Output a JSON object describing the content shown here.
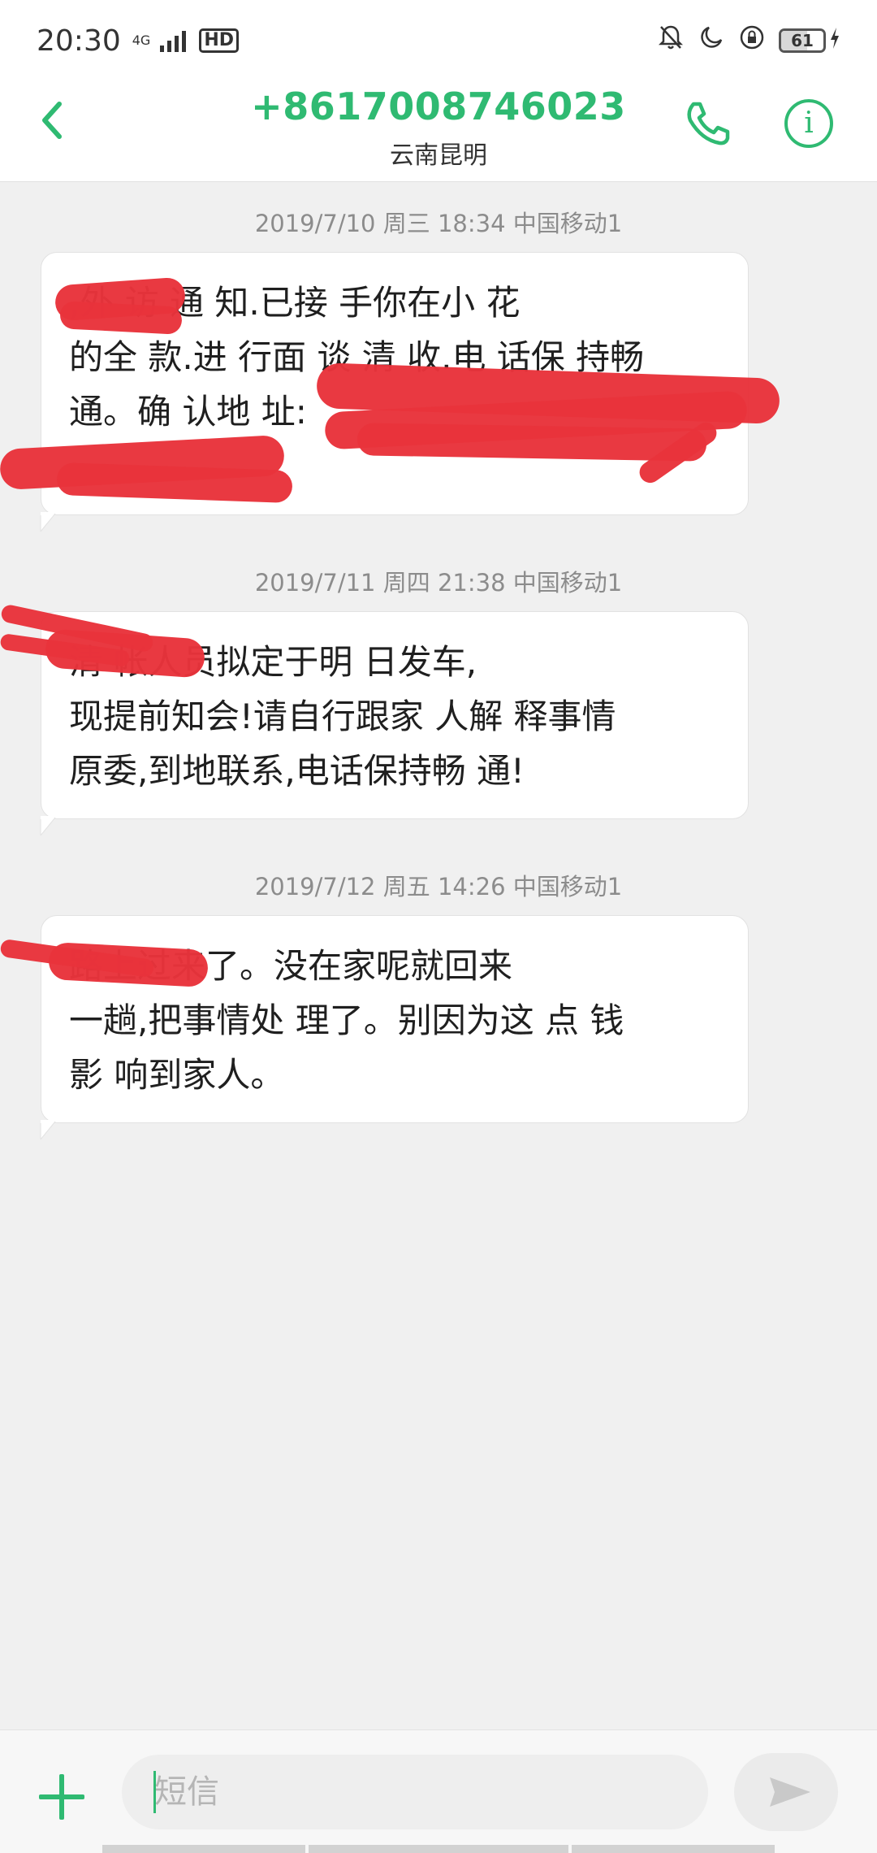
{
  "status_bar": {
    "time": "20:30",
    "network": "4G",
    "hd_label": "HD",
    "battery_level": "61",
    "icons": [
      "bell-off-icon",
      "moon-icon",
      "lock-rotation-icon",
      "battery-icon",
      "charging-icon"
    ]
  },
  "header": {
    "phone_number": "+8617008746023",
    "location": "云南昆明",
    "back_icon": "chevron-left-icon",
    "call_icon": "phone-icon",
    "info_icon": "info-icon",
    "info_glyph": "i",
    "accent_color": "#2fba72"
  },
  "messages": [
    {
      "timestamp": "2019/7/10 周三 18:34  中国移动1",
      "lines": [
        "        ,外 访  通 知.已接 手你在小 花",
        "的全 款.进 行面 谈 清 收.电 话保 持畅",
        "通。确 认地 址:"
      ]
    },
    {
      "timestamp": "2019/7/11 周四 21:38  中国移动1",
      "lines": [
        "          清 帐人员拟定于明 日发车,",
        "现提前知会!请自行跟家 人解 释事情",
        "原委,到地联系,电话保持畅 通!"
      ]
    },
    {
      "timestamp": "2019/7/12 周五 14:26  中国移动1",
      "lines": [
        "          路上过来了。没在家呢就回来",
        "一趟,把事情处 理了。别因为这 点 钱",
        "影 响到家人。"
      ]
    }
  ],
  "composer": {
    "placeholder": "短信",
    "add_icon": "plus-icon",
    "send_icon": "send-icon"
  },
  "redaction_color": "#e8333b"
}
